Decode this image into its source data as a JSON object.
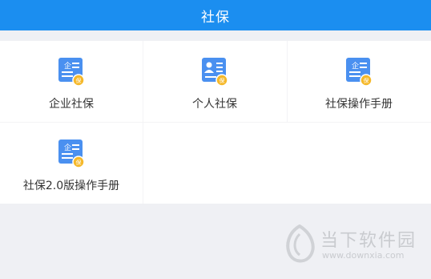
{
  "header": {
    "title": "社保"
  },
  "tiles": [
    {
      "label": "企业社保",
      "icon": "enterprise-card-icon",
      "icon_text": "企"
    },
    {
      "label": "个人社保",
      "icon": "person-card-icon"
    },
    {
      "label": "社保操作手册",
      "icon": "enterprise-card-icon",
      "icon_text": "企"
    },
    {
      "label": "社保2.0版操作手册",
      "icon": "enterprise-card-icon",
      "icon_text": "企"
    }
  ],
  "badge_text": "保",
  "colors": {
    "header": "#1b8ef0",
    "icon_card": "#4a90f0",
    "badge": "#f5b829",
    "background": "#eff0f4"
  },
  "watermark": {
    "name": "当下软件园",
    "url": "www.downxia.com"
  }
}
